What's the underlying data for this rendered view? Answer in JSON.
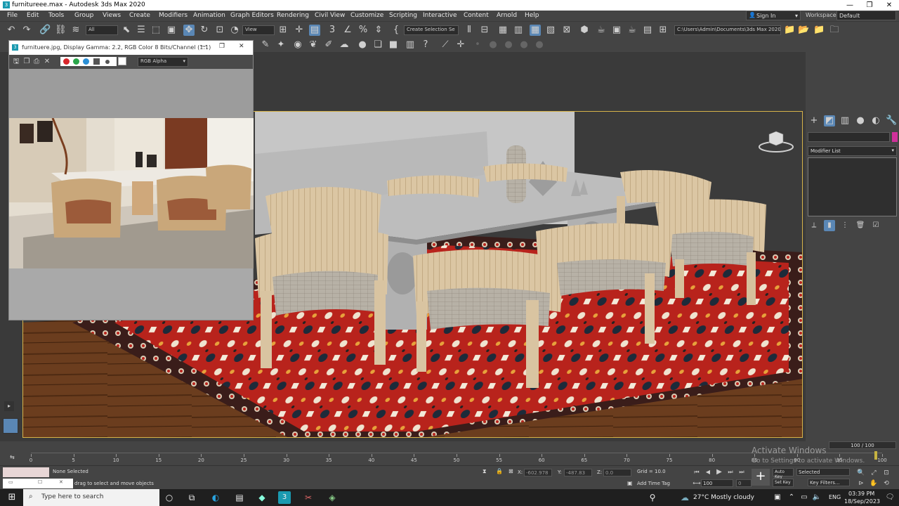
{
  "window": {
    "title": "furnitureee.max - Autodesk 3ds Max 2020",
    "app_icon": "3",
    "minimize": "—",
    "maximize": "❐",
    "close": "✕"
  },
  "menu": [
    "File",
    "Edit",
    "Tools",
    "Group",
    "Views",
    "Create",
    "Modifiers",
    "Animation",
    "Graph Editors",
    "Rendering",
    "Civil View",
    "Customize",
    "Scripting",
    "Interactive",
    "Content",
    "Arnold",
    "Help"
  ],
  "account": {
    "sign_in": "Sign In",
    "workspaces_label": "Workspaces:",
    "workspace_value": "Default"
  },
  "toolbar": {
    "filter_value": "All",
    "view_value": "View",
    "selection_set_placeholder": "Create Selection Se",
    "project_path": "C:\\Users\\Admin\\Documents\\3ds Max 2020"
  },
  "frame_buffer": {
    "title": "furnituere.jpg, Display Gamma: 2.2, RGB Color 8 Bits/Channel (1:1)",
    "channel_value": "RGB Alpha",
    "swatch_colors": [
      "#d9262b",
      "#2aa64a",
      "#2a8fd6"
    ]
  },
  "command_panel": {
    "modifier_list": "Modifier List"
  },
  "timeline": {
    "frame_counter": "100 / 100",
    "ticks": [
      "0",
      "5",
      "10",
      "15",
      "20",
      "25",
      "30",
      "35",
      "40",
      "45",
      "50",
      "55",
      "60",
      "65",
      "70",
      "75",
      "80",
      "85",
      "90",
      "95",
      "100"
    ]
  },
  "status": {
    "selection": "None Selected",
    "prompt": "drag to select and move objects",
    "x_label": "X:",
    "x_value": "-602.978",
    "y_label": "Y:",
    "y_value": "-487.83",
    "z_label": "Z:",
    "z_value": "0.0",
    "grid": "Grid = 10.0",
    "add_time_tag": "Add Time Tag",
    "auto_key": "Auto Key",
    "set_key": "Set Key",
    "selected": "Selected",
    "key_filters": "Key Filters...",
    "frame_value": "100",
    "frame_small": "0"
  },
  "watermark": {
    "line1": "Activate Windows",
    "line2": "Go to Settings to activate Windows."
  },
  "taskbar": {
    "search_placeholder": "Type here to search",
    "weather": "27°C  Mostly cloudy",
    "lang": "ENG",
    "time": "03:39 PM",
    "date": "18/Sep/2023"
  },
  "colors": {
    "accent": "#5a87b5",
    "viewport_border": "#d6b34a",
    "rug_red": "#b8231c",
    "wood": "#d9c4a1"
  }
}
